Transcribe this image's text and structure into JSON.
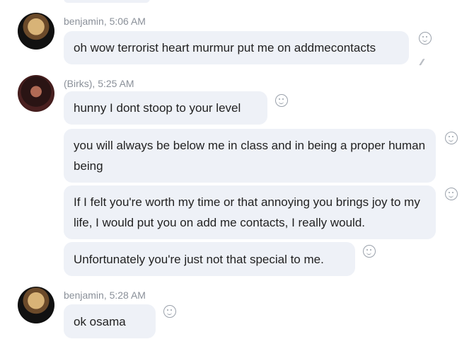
{
  "messages": [
    {
      "sender": "benjamin, 5:06 AM",
      "bubbles": [
        "oh wow terrorist heart murmur put me on addmecontacts"
      ]
    },
    {
      "sender": "(Birks), 5:25 AM",
      "bubbles": [
        "hunny I dont stoop to your level",
        "you will always be below me in class and in being a proper human being",
        "If I felt you're worth my time or that annoying you brings joy to my life, I would put you on add me contacts, I really would.",
        "Unfortunately you're just not that special to me."
      ]
    },
    {
      "sender": "benjamin, 5:28 AM",
      "bubbles": [
        "ok osama"
      ]
    }
  ],
  "icons": {
    "reaction": "smiley-face-icon",
    "read_receipt": "read-check-icon"
  },
  "colors": {
    "bubble_bg": "#eef1f7",
    "meta_text": "#8a9099"
  }
}
